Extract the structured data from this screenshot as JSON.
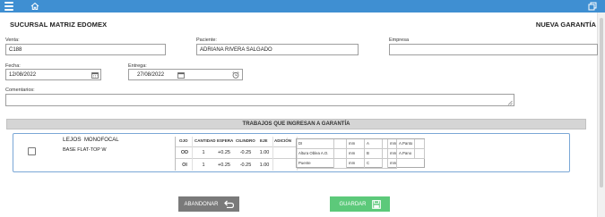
{
  "header": {
    "branch": "SUCURSAL MATRIZ EDOMEX",
    "mode": "NUEVA GARANTÍA"
  },
  "form": {
    "venta_label": "Venta:",
    "venta_value": "C188",
    "paciente_label": "Paciente:",
    "paciente_value": "ADRIANA RIVERA SALGADO",
    "empresa_label": "Empresa",
    "empresa_value": "",
    "fecha_label": "Fecha:",
    "fecha_value": "12/08/2022",
    "entrega_label": "Entrega:",
    "entrega_value": "27/08/2022",
    "comentarios_label": "Comentarios:",
    "comentarios_value": ""
  },
  "section": {
    "title": "TRABAJOS QUE INGRESAN A GARANTÍA"
  },
  "job": {
    "distance": "LEJOS",
    "type": "MONOFOCAL",
    "material": "BASE FLAT-TOP W",
    "columns": [
      "OJO",
      "CANTIDAD",
      "ESFERA",
      "CILINDRO",
      "EJE",
      "ADICIÓN"
    ],
    "rows": [
      {
        "ojo": "OD",
        "cantidad": "1",
        "esfera": "+0.25",
        "cilindro": "-0.25",
        "eje": "1.00",
        "adicion": ""
      },
      {
        "ojo": "OI",
        "cantidad": "1",
        "esfera": "+0.25",
        "cilindro": "-0.25",
        "eje": "1.00",
        "adicion": ""
      }
    ],
    "measures": {
      "di_label": "DI",
      "altura_label": "Altura Oblea A.O.",
      "puente_label": "Puente",
      "unit": "mm",
      "a_label": "A",
      "b_label": "B",
      "c_label": "C",
      "apanto_label": "A.Panto",
      "apano_label": "A.Pano"
    }
  },
  "buttons": {
    "abandon": "ABANDONAR",
    "save": "GUARDAR"
  },
  "colors": {
    "topbar": "#3f8fd2",
    "abandon": "#7a7a7a",
    "save": "#5cc97a",
    "card_border": "#7aa7d6"
  },
  "icons": {
    "menu": "hamburger-icon",
    "home": "home-icon",
    "window": "window-restore-icon",
    "calendar": "calendar-icon",
    "clock": "clock-icon",
    "undo": "undo-arrow-icon",
    "save": "floppy-disk-icon"
  }
}
